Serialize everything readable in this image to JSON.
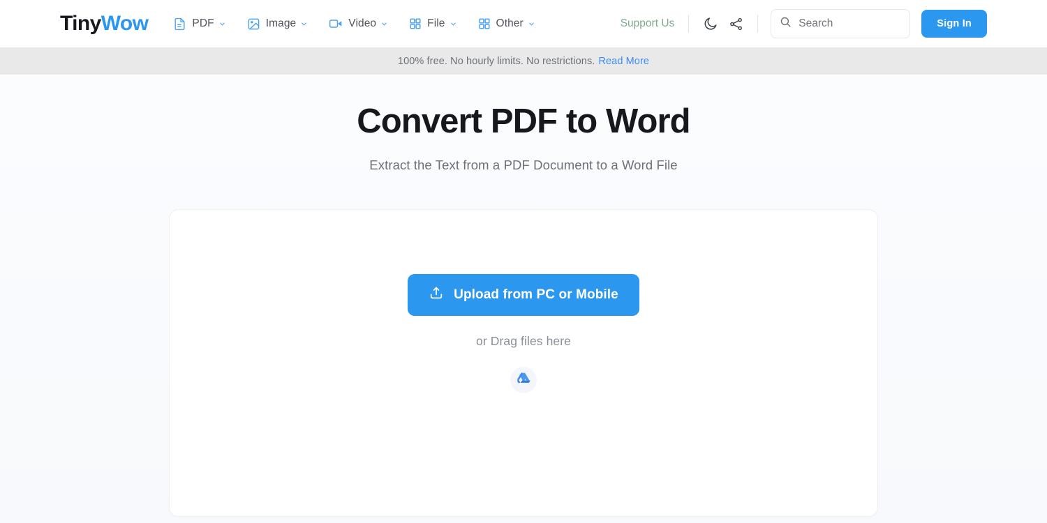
{
  "header": {
    "logo": {
      "part1": "Tiny",
      "part2": "Wow"
    },
    "nav": [
      {
        "label": "PDF",
        "icon": "document-icon",
        "has_chevron": true
      },
      {
        "label": "Image",
        "icon": "image-icon",
        "has_chevron": true
      },
      {
        "label": "Video",
        "icon": "video-camera-icon",
        "has_chevron": true
      },
      {
        "label": "File",
        "icon": "grid-icon",
        "has_chevron": true
      },
      {
        "label": "Other",
        "icon": "grid-icon",
        "has_chevron": true
      }
    ],
    "support_label": "Support Us",
    "dark_mode_icon": "moon-icon",
    "share_icon": "share-icon",
    "search": {
      "placeholder": "Search",
      "value": "",
      "icon": "search-icon"
    },
    "signin_label": "Sign In",
    "accent_color": "#2b97ef",
    "support_color": "#7faa8c"
  },
  "notice": {
    "text": "100% free. No hourly limits. No restrictions.",
    "link_label": "Read More",
    "background": "#e9e9e9",
    "link_color": "#3d8bf2"
  },
  "main": {
    "title": "Convert PDF to Word",
    "subtitle": "Extract the Text from a PDF Document to a Word File",
    "dropzone": {
      "upload_label": "Upload from PC or Mobile",
      "upload_icon": "upload-icon",
      "drag_label": "or Drag files here",
      "gdrive_icon": "google-drive-icon"
    }
  }
}
